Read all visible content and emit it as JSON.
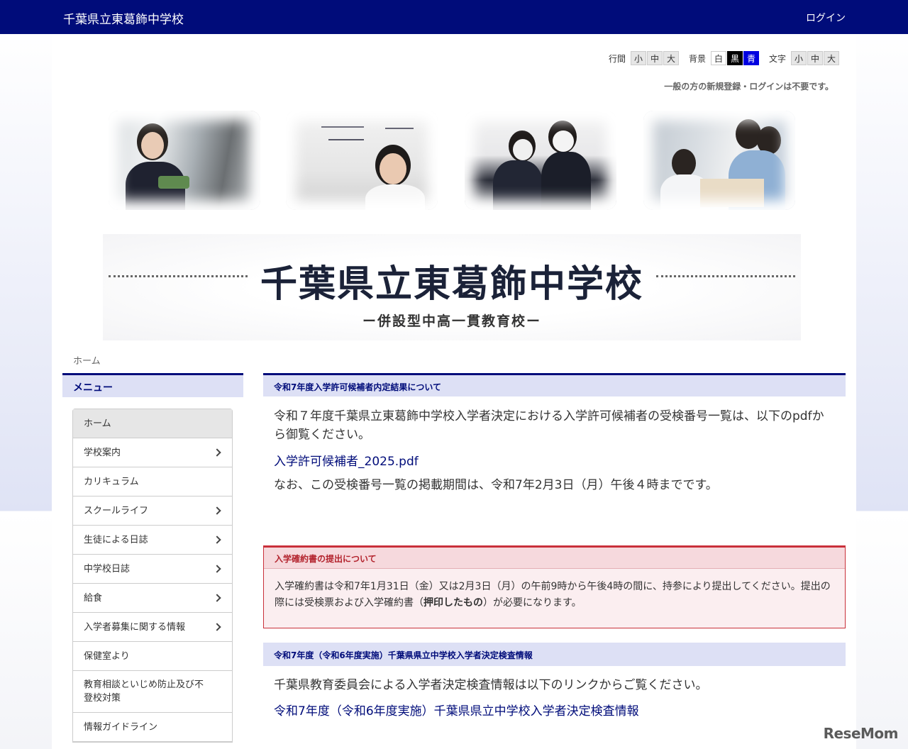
{
  "topbar": {
    "site_title": "千葉県立東葛飾中学校",
    "login": "ログイン"
  },
  "tools": {
    "line_spacing_label": "行間",
    "line_spacing": [
      "小",
      "中",
      "大"
    ],
    "background_label": "背景",
    "background": [
      "白",
      "黒",
      "青"
    ],
    "text_label": "文字",
    "text_size": [
      "小",
      "中",
      "大"
    ]
  },
  "notice": "一般の方の新規登録・ログインは不要です。",
  "banner": {
    "school_name": "千葉県立東葛飾中学校",
    "subtitle": "ー併設型中高一貫教育校ー"
  },
  "breadcrumb": "ホーム",
  "sidebar": {
    "heading": "メニュー",
    "items": [
      {
        "label": "ホーム",
        "has_children": false
      },
      {
        "label": "学校案内",
        "has_children": true
      },
      {
        "label": "カリキュラム",
        "has_children": false
      },
      {
        "label": "スクールライフ",
        "has_children": true
      },
      {
        "label": "生徒による日誌",
        "has_children": true
      },
      {
        "label": "中学校日誌",
        "has_children": true
      },
      {
        "label": "給食",
        "has_children": true
      },
      {
        "label": "入学者募集に関する情報",
        "has_children": true
      },
      {
        "label": "保健室より",
        "has_children": false
      },
      {
        "label": "教育相談といじめ防止及び不登校対策",
        "has_children": false
      },
      {
        "label": "情報ガイドライン",
        "has_children": false
      }
    ]
  },
  "main": {
    "section1": {
      "heading": "令和7年度入学許可候補者内定結果について",
      "paragraph1": "令和７年度千葉県立東葛飾中学校入学者決定における入学許可候補者の受検番号一覧は、以下のpdfから御覧ください。",
      "link": "入学許可候補者_2025.pdf",
      "paragraph2": "なお、この受検番号一覧の掲載期間は、令和7年2月3日（月）午後４時までです。"
    },
    "alert": {
      "heading": "入学確約書の提出について",
      "body_before": "入学確約書は令和7年1月31日（金）又は2月3日（月）の午前9時から午後4時の間に、持参により提出してください。提出の際には受検票および入学確約書（",
      "body_bold": "押印したもの",
      "body_after": "）が必要になります。"
    },
    "section3": {
      "heading": "令和7年度（令和6年度実施）千葉県県立中学校入学者決定検査情報",
      "paragraph": "千葉県教育委員会による入学者決定検査情報は以下のリンクからご覧ください。",
      "link": "令和7年度（令和6年度実施）千葉県県立中学校入学者決定検査情報"
    }
  },
  "watermark": "ReseMom"
}
